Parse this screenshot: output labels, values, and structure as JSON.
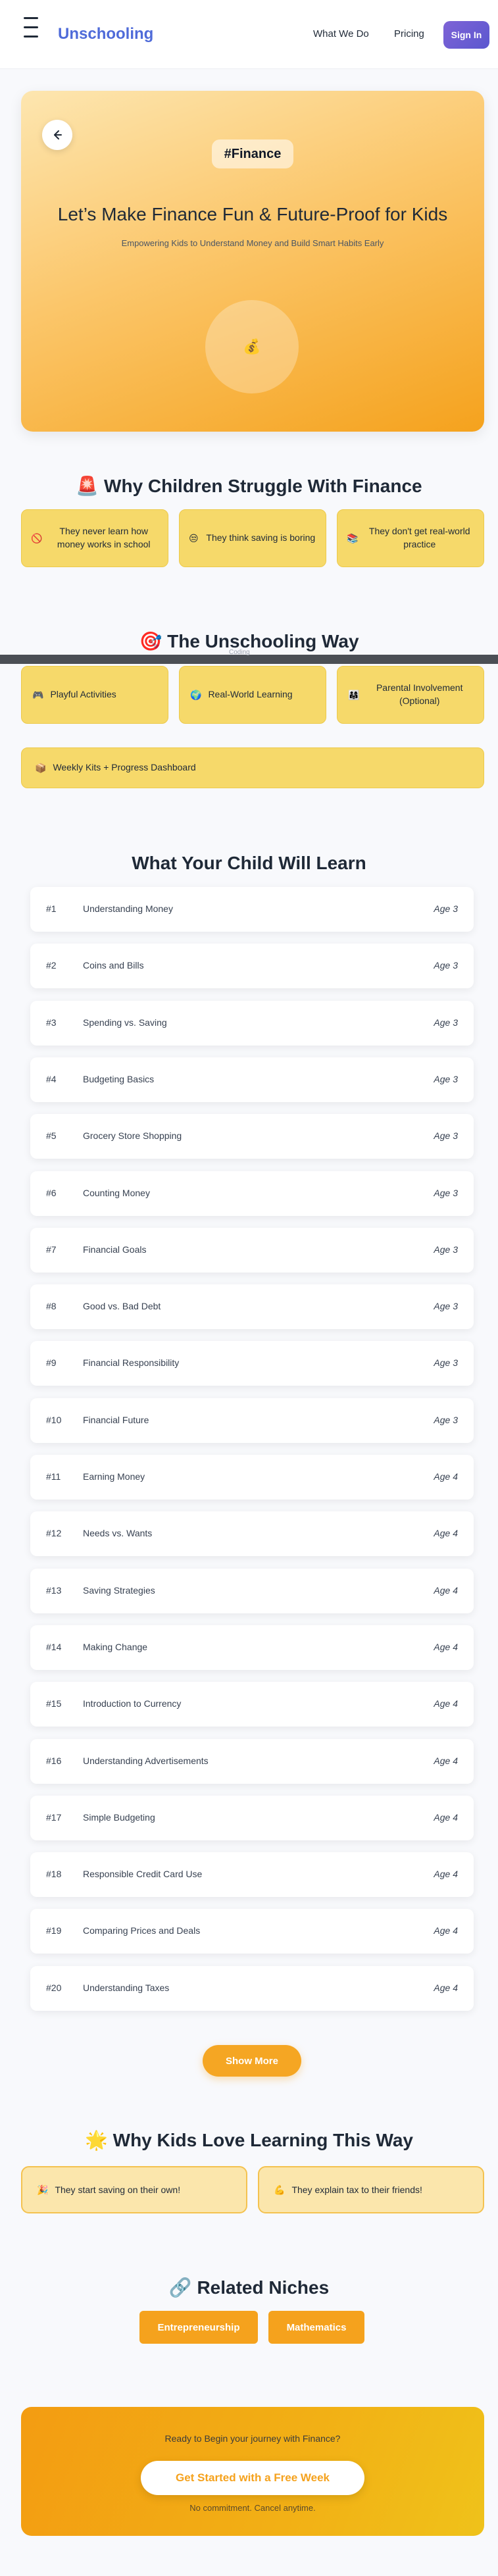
{
  "header": {
    "brand": "Unschooling",
    "nav": [
      "What We Do",
      "Pricing"
    ],
    "signin": "Sign In"
  },
  "hero": {
    "tag": "#Finance",
    "title": "Let’s Make Finance Fun & Future-Proof for Kids",
    "subtitle": "Empowering Kids to Understand Money and Build Smart Habits Early",
    "back_icon": "arrow-left-icon",
    "circle_icon": "💰"
  },
  "struggle": {
    "title": "🚨 Why Children Struggle With Finance",
    "cards": [
      {
        "icon": "🚫",
        "text": "They never learn how money works in school"
      },
      {
        "icon": "😒",
        "text": "They think saving is boring"
      },
      {
        "icon": "📚",
        "text": "They don't get real-world practice"
      }
    ]
  },
  "way": {
    "title": "🎯 The Unschooling Way",
    "divider_label": "Coding",
    "cards": [
      {
        "icon": "🎮",
        "text": "Playful Activities"
      },
      {
        "icon": "🌍",
        "text": "Real-World Learning"
      },
      {
        "icon": "👨‍👩‍👧",
        "text": "Parental Involvement (Optional)"
      }
    ],
    "wide_card": {
      "icon": "📦",
      "text": "Weekly Kits + Progress Dashboard"
    }
  },
  "learn": {
    "title": "What Your Child Will Learn",
    "lessons": [
      {
        "num": "#1",
        "name": "Understanding Money",
        "age": "Age 3"
      },
      {
        "num": "#2",
        "name": "Coins and Bills",
        "age": "Age 3"
      },
      {
        "num": "#3",
        "name": "Spending vs. Saving",
        "age": "Age 3"
      },
      {
        "num": "#4",
        "name": "Budgeting Basics",
        "age": "Age 3"
      },
      {
        "num": "#5",
        "name": "Grocery Store Shopping",
        "age": "Age 3"
      },
      {
        "num": "#6",
        "name": "Counting Money",
        "age": "Age 3"
      },
      {
        "num": "#7",
        "name": "Financial Goals",
        "age": "Age 3"
      },
      {
        "num": "#8",
        "name": "Good vs. Bad Debt",
        "age": "Age 3"
      },
      {
        "num": "#9",
        "name": "Financial Responsibility",
        "age": "Age 3"
      },
      {
        "num": "#10",
        "name": "Financial Future",
        "age": "Age 3"
      },
      {
        "num": "#11",
        "name": "Earning Money",
        "age": "Age 4"
      },
      {
        "num": "#12",
        "name": "Needs vs. Wants",
        "age": "Age 4"
      },
      {
        "num": "#13",
        "name": "Saving Strategies",
        "age": "Age 4"
      },
      {
        "num": "#14",
        "name": "Making Change",
        "age": "Age 4"
      },
      {
        "num": "#15",
        "name": "Introduction to Currency",
        "age": "Age 4"
      },
      {
        "num": "#16",
        "name": "Understanding Advertisements",
        "age": "Age 4"
      },
      {
        "num": "#17",
        "name": "Simple Budgeting",
        "age": "Age 4"
      },
      {
        "num": "#18",
        "name": "Responsible Credit Card Use",
        "age": "Age 4"
      },
      {
        "num": "#19",
        "name": "Comparing Prices and Deals",
        "age": "Age 4"
      },
      {
        "num": "#20",
        "name": "Understanding Taxes",
        "age": "Age 4"
      }
    ],
    "show_more": "Show More"
  },
  "love": {
    "title": "🌟 Why Kids Love Learning This Way",
    "cards": [
      {
        "icon": "🎉",
        "text": "They start saving on their own!"
      },
      {
        "icon": "💪",
        "text": "They explain tax to their friends!"
      }
    ]
  },
  "related": {
    "title": "🔗 Related Niches",
    "items": [
      "Entrepreneurship",
      "Mathematics"
    ]
  },
  "cta": {
    "question": "Ready to Begin your journey with Finance?",
    "button": "Get Started with a Free Week",
    "note": "No commitment. Cancel anytime."
  },
  "colors": {
    "brand": "#4f6bd9",
    "accent": "#f5a21d",
    "card_yellow": "#f6d96a"
  }
}
